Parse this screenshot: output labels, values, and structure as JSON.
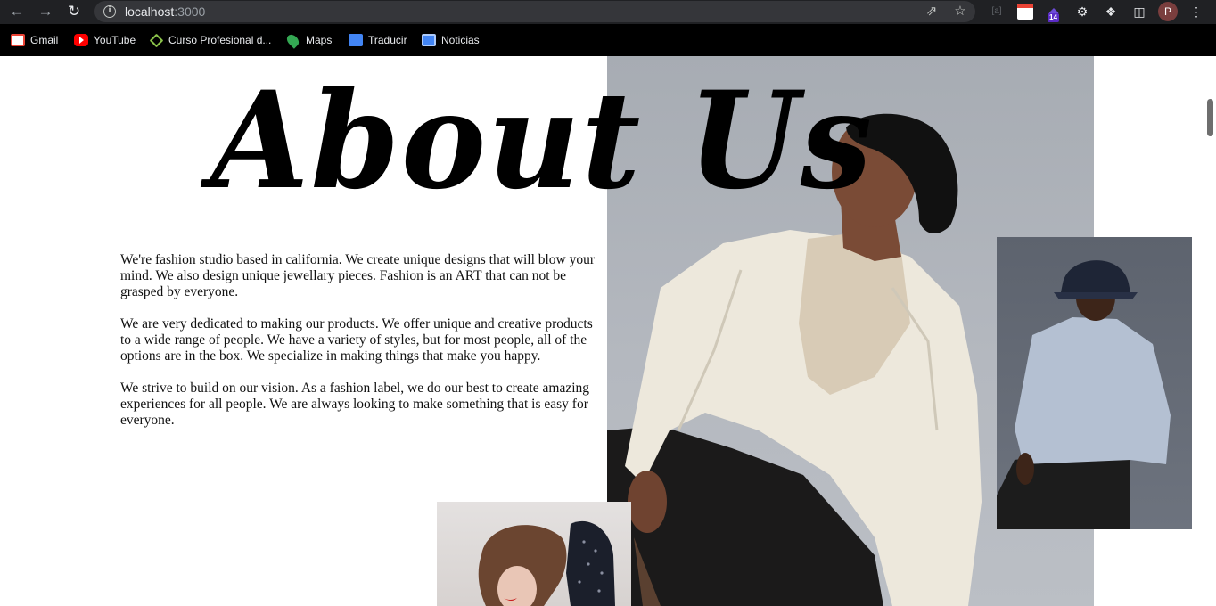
{
  "browser": {
    "url_host": "localhost",
    "url_port": ":3000",
    "profile_initial": "P",
    "extension_badge": "14",
    "bookmarks": [
      {
        "label": "Gmail",
        "icon": "gmail-icon"
      },
      {
        "label": "YouTube",
        "icon": "youtube-icon"
      },
      {
        "label": "Curso Profesional d...",
        "icon": "curso-icon"
      },
      {
        "label": "Maps",
        "icon": "maps-icon"
      },
      {
        "label": "Traducir",
        "icon": "translate-icon"
      },
      {
        "label": "Noticias",
        "icon": "news-icon"
      }
    ]
  },
  "page": {
    "title": "About Us",
    "paragraphs": [
      "We're fashion studio based in california. We create unique designs that will blow your mind. We also design unique jewellary pieces. Fashion is an ART that can not be grasped by everyone.",
      "We are very dedicated to making our products. We offer unique and creative products to a wide range of people. We have a variety of styles, but for most people, all of the options are in the box. We specialize in making things that make you happy.",
      "We strive to build on our vision. As a fashion label, we do our best to create amazing experiences for all people. We are always looking to make something that is easy for everyone."
    ]
  },
  "colors": {
    "chrome_bg": "#202124",
    "bookmarks_bg": "#000000",
    "page_bg": "#ffffff",
    "title_color": "#000000"
  }
}
